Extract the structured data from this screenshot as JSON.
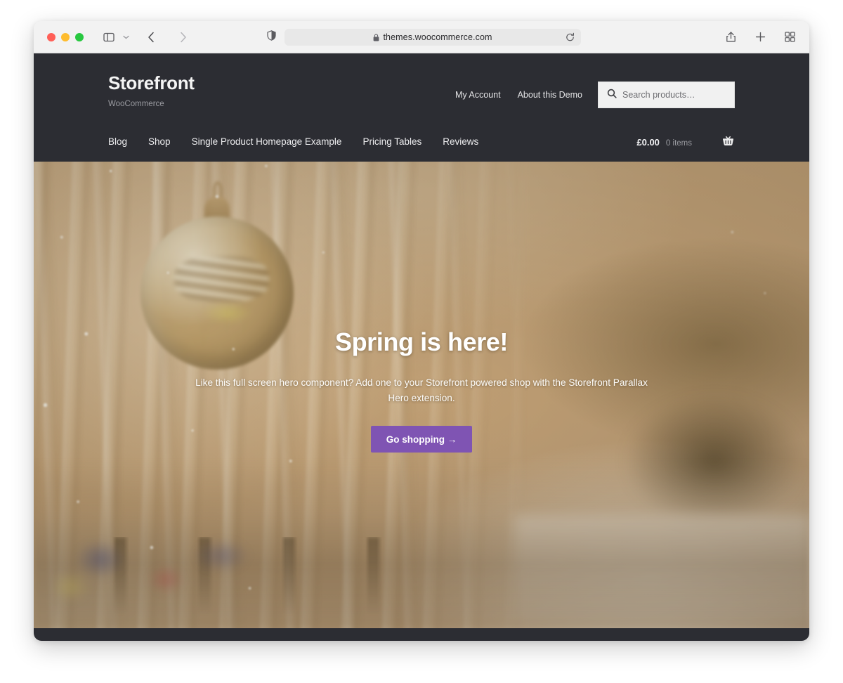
{
  "browser": {
    "traffic_lights": [
      "close",
      "minimize",
      "maximize"
    ],
    "sidebar_toggle_icon": "sidebar-icon",
    "tab_group_chevron_icon": "chevron-down-icon",
    "back_icon": "chevron-left-icon",
    "forward_icon": "chevron-right-icon",
    "shield_icon": "privacy-shield-icon",
    "lock_icon": "lock-icon",
    "url": "themes.woocommerce.com",
    "reload_icon": "reload-icon",
    "share_icon": "share-icon",
    "new_tab_icon": "plus-icon",
    "tab_overview_icon": "tab-overview-icon"
  },
  "site": {
    "header": {
      "brand_title": "Storefront",
      "brand_tagline": "WooCommerce",
      "secondary_nav": [
        {
          "label": "My Account"
        },
        {
          "label": "About this Demo"
        }
      ],
      "search": {
        "placeholder": "Search products…",
        "value": "",
        "icon": "search-icon"
      },
      "background_color": "#2c2d33"
    },
    "nav": {
      "items": [
        {
          "label": "Blog"
        },
        {
          "label": "Shop"
        },
        {
          "label": "Single Product Homepage Example"
        },
        {
          "label": "Pricing Tables"
        },
        {
          "label": "Reviews"
        }
      ],
      "cart": {
        "total": "£0.00",
        "count": "0 items",
        "icon": "shopping-basket-icon"
      }
    },
    "hero": {
      "title": "Spring is here!",
      "subtitle": "Like this full screen hero component? Add one to your Storefront powered shop with the Storefront Parallax Hero extension.",
      "button_label": "Go shopping →",
      "button_color": "#7f54b3"
    }
  }
}
